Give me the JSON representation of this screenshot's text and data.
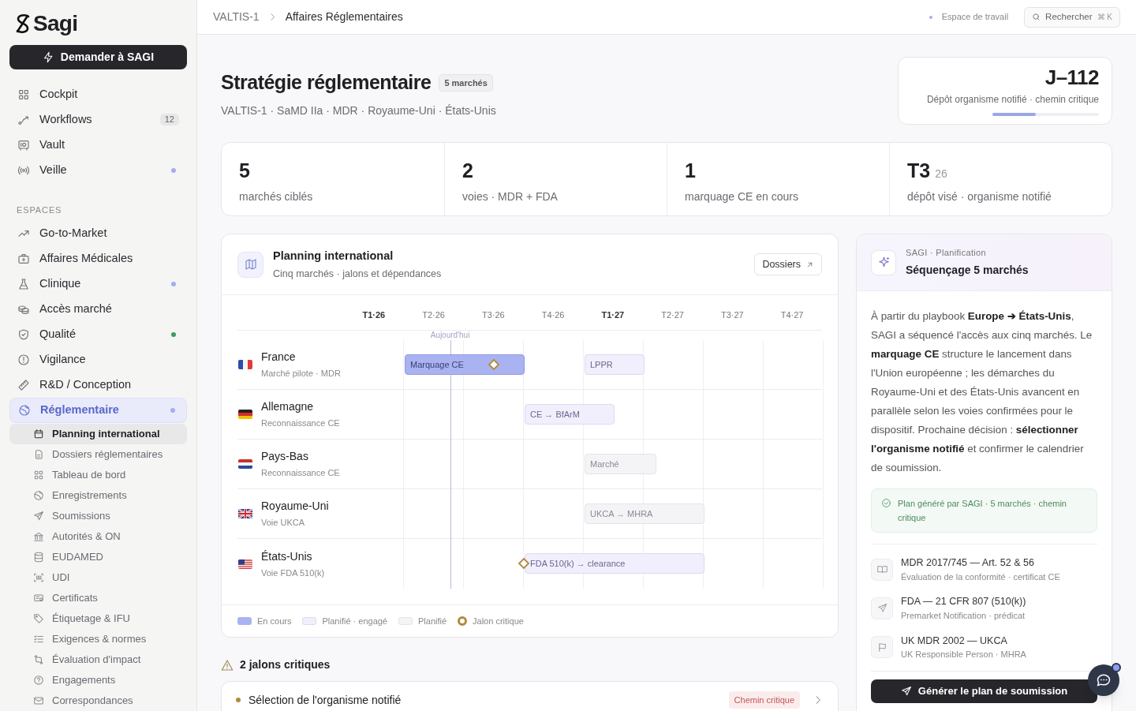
{
  "sidebar": {
    "logo": "Sagi",
    "ask_button": "Demander à SAGI",
    "items": [
      {
        "label": "Cockpit"
      },
      {
        "label": "Workflows",
        "badge": "12"
      },
      {
        "label": "Vault"
      },
      {
        "label": "Veille",
        "color": "#a3aef0"
      }
    ],
    "section_label": "ESPACES",
    "spaces": [
      {
        "label": "Go-to-Market",
        "selected": false
      },
      {
        "label": "Affaires Médicales",
        "selected": false
      },
      {
        "label": "Clinique",
        "selected": false,
        "color": "#a3aef0"
      },
      {
        "label": "Accès marché",
        "selected": false
      },
      {
        "label": "Qualité",
        "selected": false,
        "color": "#3f9a63"
      },
      {
        "label": "Vigilance",
        "selected": false
      },
      {
        "label": "R&D / Conception",
        "selected": false
      },
      {
        "label": "Réglementaire",
        "selected": true,
        "color": "#a3aef0",
        "children": [
          {
            "label": "Planning international",
            "selected": true
          },
          {
            "label": "Dossiers réglementaires",
            "selected": false
          },
          {
            "label": "Tableau de bord",
            "selected": false
          },
          {
            "label": "Enregistrements",
            "selected": false
          },
          {
            "label": "Soumissions",
            "selected": false
          },
          {
            "label": "Autorités & ON",
            "selected": false
          },
          {
            "label": "EUDAMED",
            "selected": false
          },
          {
            "label": "UDI",
            "selected": false
          },
          {
            "label": "Certificats",
            "selected": false
          },
          {
            "label": "Étiquetage & IFU",
            "selected": false
          },
          {
            "label": "Exigences & normes",
            "selected": false
          },
          {
            "label": "Évaluation d'impact",
            "selected": false
          },
          {
            "label": "Engagements",
            "selected": false
          },
          {
            "label": "Correspondances",
            "selected": false
          }
        ]
      }
    ]
  },
  "topbar": {
    "breadcrumb": [
      "VALTIS-1",
      "Affaires Réglementaires"
    ],
    "workspace": "Espace de travail",
    "search": "Rechercher",
    "shortcut": "⌘ K"
  },
  "header": {
    "title": "Stratégie réglementaire",
    "badge": "5 marchés",
    "subtitle": "VALTIS-1 · SaMD IIa · MDR · Royaume-Uni · États-Unis",
    "countdown": {
      "value": "J–112",
      "label": "Dépôt organisme notifié · chemin critique",
      "level": 0.41
    }
  },
  "stats": [
    {
      "value": "5",
      "label": "marchés ciblés"
    },
    {
      "value": "2",
      "label": "voies · MDR + FDA"
    },
    {
      "value": "1",
      "label": "marquage CE en cours"
    },
    {
      "value": "T3",
      "suffix": "26",
      "label": "dépôt visé · organisme notifié"
    }
  ],
  "planning": {
    "title": "Planning international",
    "subtitle": "Cinq marchés · jalons et dépendances",
    "button": "Dossiers",
    "quarters": [
      {
        "label": "T1·26",
        "emphasis": true
      },
      {
        "label": "T2·26",
        "emphasis": false
      },
      {
        "label": "T3·26",
        "emphasis": false
      },
      {
        "label": "T4·26",
        "emphasis": false
      },
      {
        "label": "T1·27",
        "emphasis": true
      },
      {
        "label": "T2·27",
        "emphasis": false
      },
      {
        "label": "T3·27",
        "emphasis": false
      },
      {
        "label": "T4·27",
        "emphasis": false
      }
    ],
    "today": "Aujourd'hui",
    "rows": [
      {
        "name": "France",
        "note": "Marché pilote · MDR",
        "bars": [
          {
            "label": "Marquage CE",
            "kind": "in_progress",
            "milestone": true
          },
          {
            "label": "LPPR",
            "kind": "engaged",
            "milestone": false
          }
        ]
      },
      {
        "name": "Allemagne",
        "note": "Reconnaissance CE",
        "bars": [
          {
            "label": "CE → BfArM",
            "kind": "engaged",
            "milestone": false
          }
        ]
      },
      {
        "name": "Pays-Bas",
        "note": "Reconnaissance CE",
        "bars": [
          {
            "label": "Marché",
            "kind": "planned",
            "milestone": false
          }
        ]
      },
      {
        "name": "Royaume-Uni",
        "note": "Voie UKCA",
        "bars": [
          {
            "label": "UKCA → MHRA",
            "kind": "planned",
            "milestone": false
          }
        ]
      },
      {
        "name": "États-Unis",
        "note": "Voie FDA 510(k)",
        "bars": [
          {
            "label": "FDA 510(k) → clearance",
            "kind": "engaged",
            "milestone": true
          }
        ]
      }
    ],
    "legend": [
      {
        "label": "En cours",
        "kind": "in_progress"
      },
      {
        "label": "Planifié · engagé",
        "kind": "engaged"
      },
      {
        "label": "Planifié",
        "kind": "planned"
      },
      {
        "label": "Jalon critique",
        "kind": "milestone"
      }
    ]
  },
  "critical": {
    "title": "2 jalons critiques",
    "items": [
      {
        "label": "Sélection de l'organisme notifié",
        "badge": "Chemin critique"
      }
    ]
  },
  "assistant": {
    "eyebrow": "SAGI · Planification",
    "title": "Séquençage 5 marchés",
    "text": "À partir du playbook **Europe ➔ États-Unis**, SAGI a séquencé l'accès aux cinq marchés. Le **marquage CE** structure le lancement dans l'Union européenne ; les démarches du Royaume-Uni et des États-Unis avancent en parallèle selon les voies confirmées pour le dispositif. Prochaine décision : **sélectionner l'organisme notifié** et confirmer le calendrier de soumission.",
    "note": "Plan généré par SAGI · 5 marchés · chemin critique",
    "references": [
      {
        "title": "MDR 2017/745 — Art. 52 & 56",
        "subtitle": "Évaluation de la conformité · certificat CE"
      },
      {
        "title": "FDA — 21 CFR 807 (510(k))",
        "subtitle": "Premarket Notification · prédicat"
      },
      {
        "title": "UK MDR 2002 — UKCA",
        "subtitle": "UK Responsible Person · MHRA"
      }
    ],
    "button": "Générer le plan de soumission"
  }
}
